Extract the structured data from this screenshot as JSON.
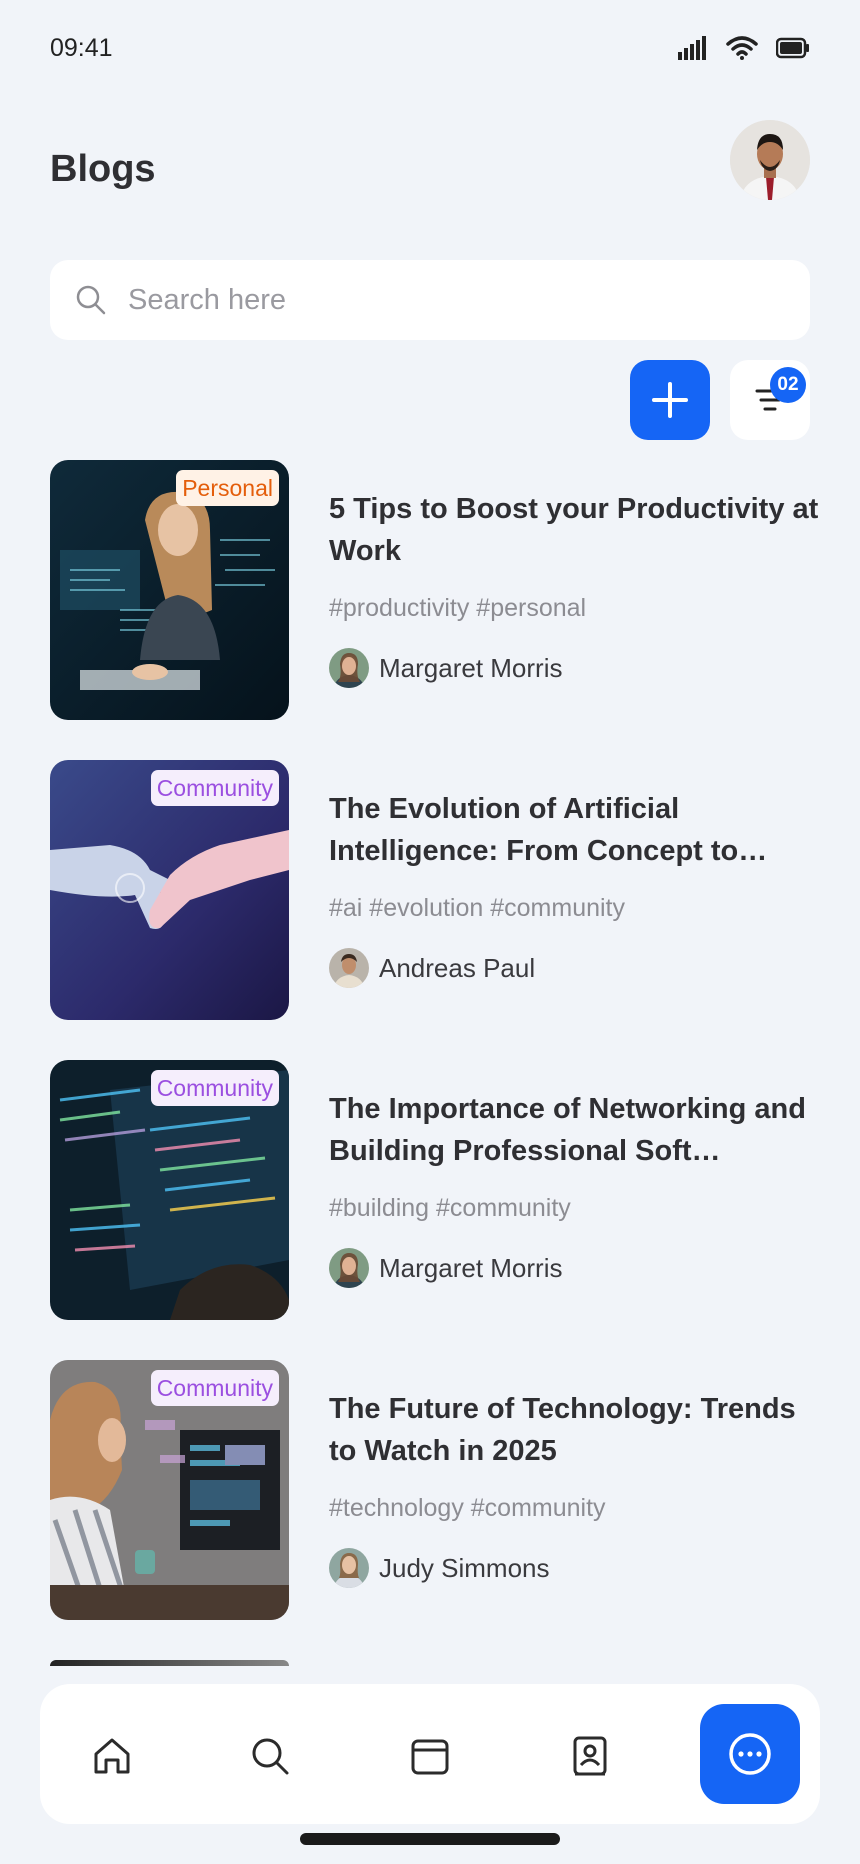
{
  "status": {
    "time": "09:41"
  },
  "header": {
    "title": "Blogs"
  },
  "search": {
    "placeholder": "Search here"
  },
  "filter": {
    "badge": "02"
  },
  "blogs": [
    {
      "category": "Personal",
      "title": "5 Tips to Boost your Productivity at Work",
      "tags": "#productivity #personal",
      "author": "Margaret Morris"
    },
    {
      "category": "Community",
      "title": "The Evolution of Artificial Intelligence: From Concept to…",
      "tags": "#ai #evolution #community",
      "author": "Andreas Paul"
    },
    {
      "category": "Community",
      "title": "The Importance of Networking and Building Professional Soft…",
      "tags": "#building #community",
      "author": "Margaret Morris"
    },
    {
      "category": "Community",
      "title": "The Future of Technology: Trends to Watch in 2025",
      "tags": "#technology #community",
      "author": "Judy Simmons"
    }
  ],
  "nav": [
    "home-icon",
    "search-icon",
    "calendar-icon",
    "contacts-icon",
    "chat-icon"
  ],
  "colors": {
    "accent": "#1565f5",
    "background": "#f1f4f9",
    "personal": "#e45e0b",
    "community": "#9b4fe0"
  }
}
